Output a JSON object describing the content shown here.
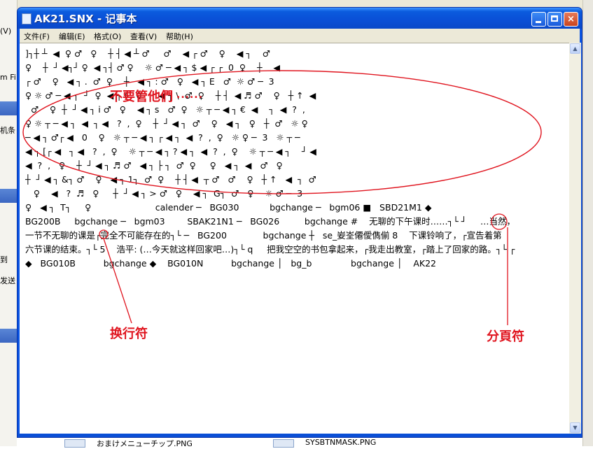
{
  "window": {
    "title": "AK21.SNX - 记事本",
    "buttons": {
      "minimize": "minimize",
      "maximize": "maximize",
      "close": "×"
    }
  },
  "menu": [
    {
      "label": "文件(F)"
    },
    {
      "label": "编辑(E)"
    },
    {
      "label": "格式(O)"
    },
    {
      "label": "查看(V)"
    },
    {
      "label": "帮助(H)"
    }
  ],
  "content_lines": [
    "]┐┼ ┴  ◀  ♀ ♂   ♀    ┼ ┤ ◀ ┴ ♂     ♂    ◀ ┌ ♂    ♀    ◀ ┐    ♂",
    "♀    ┼  ┘ ◀┐┘ ♀  ◀ ┐┤ ♂ ♀    ☼ ♂ ─ ◀ ┐ $ ◀ ┌ ┌  0  ♀    ┼    ◀",
    "┌ ♂    ♀   ◀ ┐ .  ♂  ♀    ┼   ◀ ┐ : ♂   ♀   ◀ ┐ E   ♂  ☼ ♂ ─  3",
    "♀ ☼ ♂ ─ ◀ ┐  ┘  ♀  ◀ ┐ (   0      ◀ ┐ \\  ♂  ♀    ┼ ┤  ◀ ♬ ♂    ♀   ┼ ↑  ◀",
    "  ♂    ♀  ┼  ┘ ◀ ┐ i ♂   ♀    ◀ ┐ s   ♂  ♀   ☼ ┬ ─ ◀ ┐ €  ◀    ┐  ◀  ?  ,",
    "♀ ☼ ┬ ─ ◀ ┐  ◀  ┐ ◀   ?  ,  ♀    ┼  ┘ ◀ ┐  ♂    ♀   ◀ ┐   ♀   ┼  ♂   ☼ ♀",
    "─ ◀ ┐ ♂┌ ◀   0    ♀   ☼ ┬ ─ ◀ ┐ ┌ ◀ ┐  ◀  ?  ,  ♀   ☼ ♀ ─  3   ☼ ┬ ─",
    "◀ ┐ [┌ ◀   ┐ ◀   ?  ,  ♀    ☼ ┬ ─ ◀ ┐ ? ◀ ┐  ◀  ?  ,  ♀    ☼ ┬ ─ ◀ ┐    ┘ ◀",
    "◀  ?  ,   ♀    ┼  ┘ ◀ ┐ ♬ ♂   ◀ ┐ ├ ┐  ♂  ♀     ♀   ◀ ┐  ◀   ♂   ♀",
    "┼  ┘ ◀ ┐ &┐ ♂    ♀   ◀ ┐ 1┐  ♂  ♀    ┼ ┤ ◀  ┬ ♂   ♂    ♀   ┼ ↑   ◀  ┐  ♂",
    "   ♀    ◀   ?  ♬   ♀     ┼  ┘ ◀ ┐ > ♂   ♀    ◀ ┐  G┐  ♂   ♀    ☼ ♂ ─  3",
    "♀   ◀ ┐  T┐     ♀                       calender ─   BG030           bgchange ─   bgm06 ■   SBD21M1 ◆",
    "BG200B     bgchange ─   bgm03        SBAK21N1 ─   BG026         bgchange #    无聊的下午课时……┐└ ┘     …当然，",
    "一节不无聊的课是┌完全不可能存在的┐└ ─   BG200             bgchange ┼   se_妛峑僊僾儁偂 8    下课铃响了，┌宣告着第",
    "六节课的结束。┐└ 5    浩平: (…今天就这样回家吧…)┐└ q     把我空空的书包拿起来，┌我走出教室，┌踏上了回家的路。┐└ ┌",
    "◆   BG010B          bgchange ◆    BG010N          bgchange │   bg_b              bgchange │    AK22"
  ],
  "annotations": {
    "ignore": "不要管他們",
    "ignore_dots": "......",
    "newline": "换行符",
    "pagebreak": "分頁符"
  },
  "colors": {
    "annotation": "#e0141e",
    "titlebar": "#0a54e3"
  },
  "background": {
    "left_labels": [
      "(V)",
      "m Fi",
      "机条",
      "到",
      "发送"
    ],
    "files": [
      "おまけメニューチップ.PNG",
      "SYSBTNMASK.PNG"
    ]
  }
}
